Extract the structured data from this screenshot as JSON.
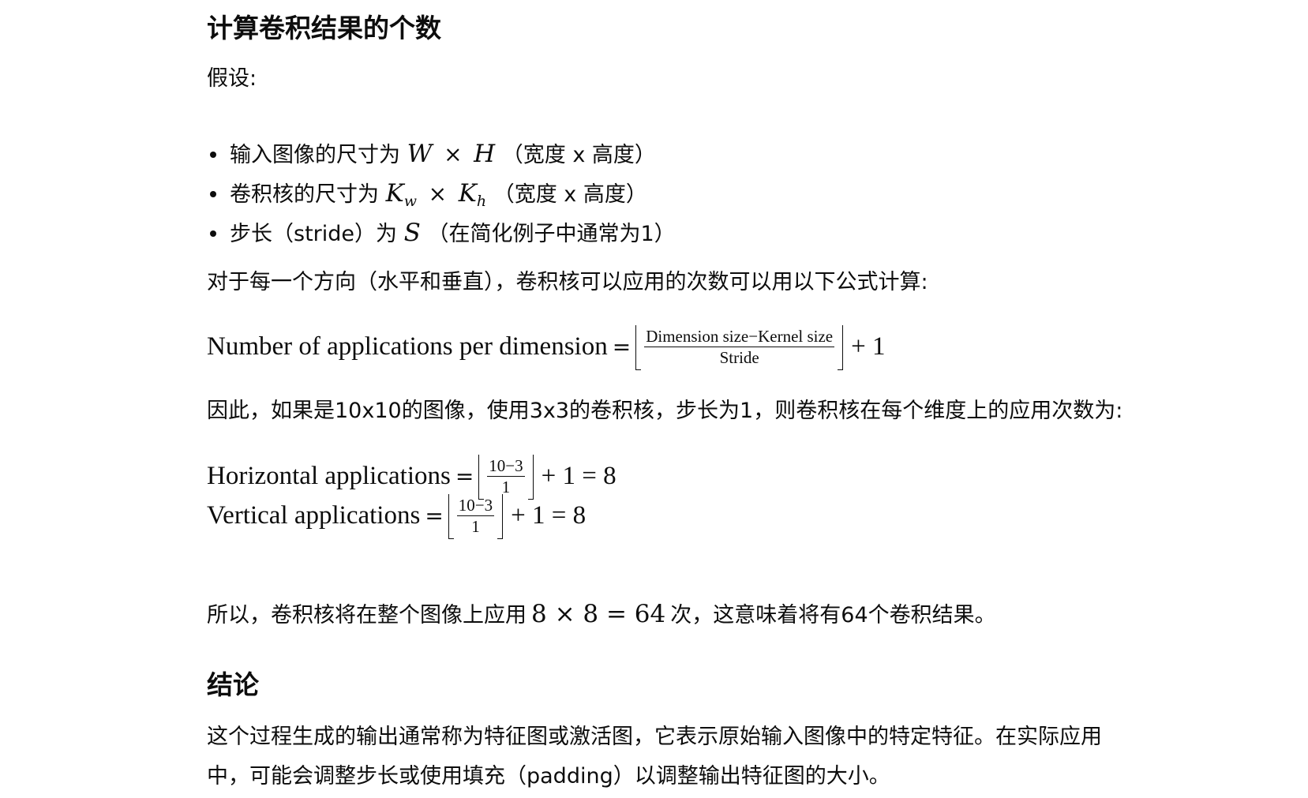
{
  "section1": {
    "title": "计算卷积结果的个数",
    "assume": "假设:",
    "bullets": [
      {
        "prefix": "输入图像的尺寸为",
        "a": "W",
        "times": "×",
        "b": "H",
        "suffix": "（宽度 x 高度）"
      },
      {
        "prefix": "卷积核的尺寸为",
        "a": "K",
        "a_sub": "w",
        "times": "×",
        "b": "K",
        "b_sub": "h",
        "suffix": "（宽度 x 高度）"
      },
      {
        "prefix": "步长（stride）为",
        "a": "S",
        "suffix": "（在简化例子中通常为1）"
      }
    ],
    "formula_intro": "对于每一个方向（水平和垂直），卷积核可以应用的次数可以用以下公式计算:",
    "formula": {
      "lhs": "Number of applications per dimension",
      "eq": "=",
      "num": "Dimension size−Kernel size",
      "den": "Stride",
      "plus": "+ 1"
    },
    "example_intro": "因此，如果是10x10的图像，使用3x3的卷积核，步长为1，则卷积核在每个维度上的应用次数为:",
    "horizontal": {
      "lhs": "Horizontal applications",
      "eq": "=",
      "num": "10−3",
      "den": "1",
      "rhs": "+ 1 = 8"
    },
    "vertical": {
      "lhs": "Vertical applications",
      "eq": "=",
      "num": "10−3",
      "den": "1",
      "rhs": "+ 1 = 8"
    },
    "result": {
      "prefix": "所以，卷积核将在整个图像上应用",
      "math": "8 × 8 = 64",
      "suffix": "次，这意味着将有64个卷积结果。"
    }
  },
  "section2": {
    "title": "结论",
    "line1": "这个过程生成的输出通常称为特征图或激活图，它表示原始输入图像中的特定特征。在实际应用",
    "line2": "中，可能会调整步长或使用填充（padding）以调整输出特征图的大小。"
  }
}
